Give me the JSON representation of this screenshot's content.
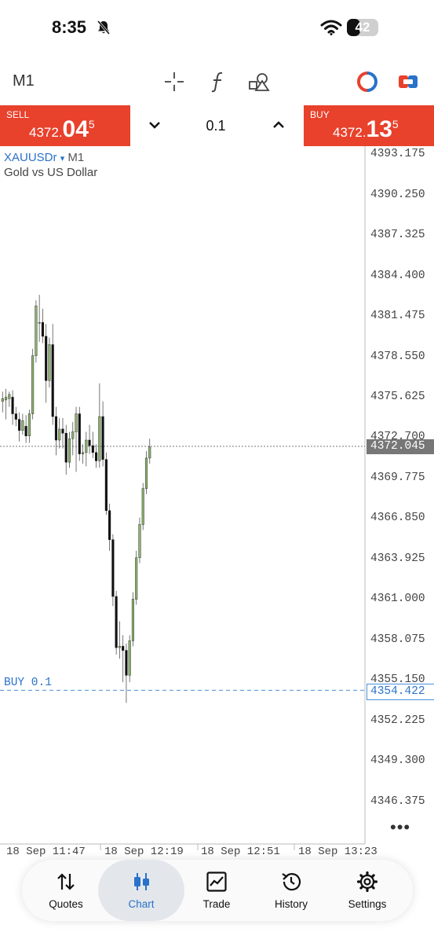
{
  "status": {
    "time": "8:35",
    "battery": "42"
  },
  "toolbar": {
    "timeframe": "M1"
  },
  "trade": {
    "sell": {
      "label": "SELL",
      "price_prefix": "4372.",
      "price_big": "04",
      "price_sup": "5"
    },
    "buy": {
      "label": "BUY",
      "price_prefix": "4372.",
      "price_big": "13",
      "price_sup": "5"
    },
    "volume": "0.1"
  },
  "chart": {
    "symbol": "XAUUSDr",
    "symbol_arrow": "▾",
    "timeframe": "M1",
    "description": "Gold vs US Dollar",
    "price_labels": [
      "4393.175",
      "4390.250",
      "4387.325",
      "4384.400",
      "4381.475",
      "4378.550",
      "4375.625",
      "4372.700",
      "4369.775",
      "4366.850",
      "4363.925",
      "4361.000",
      "4358.075",
      "4355.150",
      "4352.225",
      "4349.300",
      "4346.375"
    ],
    "current_price": "4372.045",
    "position_label": "BUY 0.1",
    "position_price": "4354.422",
    "time_labels": [
      "18 Sep 11:47",
      "18 Sep 12:19",
      "18 Sep 12:51",
      "18 Sep 13:23"
    ],
    "more_label": "•••"
  },
  "chart_data": {
    "type": "candlestick",
    "symbol": "XAUUSDr",
    "timeframe": "M1",
    "ylim": [
      4345.5,
      4394.0
    ],
    "candles": [
      {
        "o": 4375.3,
        "h": 4376.0,
        "l": 4374.5,
        "c": 4375.5
      },
      {
        "o": 4375.4,
        "h": 4376.2,
        "l": 4374.0,
        "c": 4375.6
      },
      {
        "o": 4375.5,
        "h": 4376.0,
        "l": 4374.9,
        "c": 4375.8
      },
      {
        "o": 4375.6,
        "h": 4376.1,
        "l": 4373.6,
        "c": 4374.4
      },
      {
        "o": 4374.4,
        "h": 4374.9,
        "l": 4373.5,
        "c": 4374.0
      },
      {
        "o": 4374.0,
        "h": 4374.5,
        "l": 4372.4,
        "c": 4373.2
      },
      {
        "o": 4373.2,
        "h": 4374.4,
        "l": 4372.9,
        "c": 4373.9
      },
      {
        "o": 4373.5,
        "h": 4374.3,
        "l": 4372.3,
        "c": 4372.8
      },
      {
        "o": 4372.8,
        "h": 4374.7,
        "l": 4372.3,
        "c": 4374.4
      },
      {
        "o": 4374.4,
        "h": 4379.1,
        "l": 4374.0,
        "c": 4378.6
      },
      {
        "o": 4378.6,
        "h": 4382.6,
        "l": 4378.1,
        "c": 4382.2
      },
      {
        "o": 4381.0,
        "h": 4383.0,
        "l": 4379.6,
        "c": 4381.0
      },
      {
        "o": 4381.0,
        "h": 4382.0,
        "l": 4379.5,
        "c": 4380.0
      },
      {
        "o": 4380.0,
        "h": 4380.9,
        "l": 4375.2,
        "c": 4376.8
      },
      {
        "o": 4376.8,
        "h": 4379.9,
        "l": 4376.3,
        "c": 4379.4
      },
      {
        "o": 4379.4,
        "h": 4380.9,
        "l": 4373.6,
        "c": 4374.2
      },
      {
        "o": 4374.2,
        "h": 4374.9,
        "l": 4371.4,
        "c": 4372.5
      },
      {
        "o": 4372.5,
        "h": 4374.1,
        "l": 4371.9,
        "c": 4373.3
      },
      {
        "o": 4373.3,
        "h": 4374.1,
        "l": 4371.9,
        "c": 4373.0
      },
      {
        "o": 4373.0,
        "h": 4373.6,
        "l": 4370.0,
        "c": 4370.9
      },
      {
        "o": 4370.9,
        "h": 4373.1,
        "l": 4370.5,
        "c": 4372.6
      },
      {
        "o": 4372.6,
        "h": 4373.8,
        "l": 4371.4,
        "c": 4373.1
      },
      {
        "o": 4373.1,
        "h": 4374.9,
        "l": 4370.2,
        "c": 4374.4
      },
      {
        "o": 4374.4,
        "h": 4374.9,
        "l": 4371.0,
        "c": 4371.5
      },
      {
        "o": 4371.5,
        "h": 4372.2,
        "l": 4370.8,
        "c": 4371.6
      },
      {
        "o": 4371.6,
        "h": 4373.1,
        "l": 4370.6,
        "c": 4372.5
      },
      {
        "o": 4372.5,
        "h": 4373.6,
        "l": 4371.5,
        "c": 4372.1
      },
      {
        "o": 4372.1,
        "h": 4373.1,
        "l": 4371.2,
        "c": 4371.6
      },
      {
        "o": 4371.6,
        "h": 4372.2,
        "l": 4370.5,
        "c": 4371.0
      },
      {
        "o": 4371.0,
        "h": 4376.6,
        "l": 4370.5,
        "c": 4374.2
      },
      {
        "o": 4374.2,
        "h": 4375.3,
        "l": 4370.6,
        "c": 4371.1
      },
      {
        "o": 4371.1,
        "h": 4371.6,
        "l": 4367.1,
        "c": 4367.4
      },
      {
        "o": 4367.4,
        "h": 4367.9,
        "l": 4364.5,
        "c": 4365.3
      },
      {
        "o": 4365.3,
        "h": 4365.7,
        "l": 4360.5,
        "c": 4361.2
      },
      {
        "o": 4361.2,
        "h": 4361.6,
        "l": 4357.0,
        "c": 4357.5
      },
      {
        "o": 4357.5,
        "h": 4359.4,
        "l": 4356.7,
        "c": 4357.6
      },
      {
        "o": 4357.6,
        "h": 4358.4,
        "l": 4355.0,
        "c": 4357.3
      },
      {
        "o": 4357.3,
        "h": 4357.8,
        "l": 4353.5,
        "c": 4355.5
      },
      {
        "o": 4355.5,
        "h": 4358.4,
        "l": 4355.0,
        "c": 4358.0
      },
      {
        "o": 4358.0,
        "h": 4361.5,
        "l": 4357.6,
        "c": 4361.0
      },
      {
        "o": 4361.0,
        "h": 4364.5,
        "l": 4360.6,
        "c": 4364.0
      },
      {
        "o": 4364.0,
        "h": 4366.9,
        "l": 4363.6,
        "c": 4366.4
      },
      {
        "o": 4366.4,
        "h": 4369.4,
        "l": 4366.0,
        "c": 4369.0
      },
      {
        "o": 4369.0,
        "h": 4371.7,
        "l": 4368.6,
        "c": 4371.2
      },
      {
        "o": 4371.2,
        "h": 4372.6,
        "l": 4370.8,
        "c": 4372.0
      }
    ],
    "reference_lines": [
      {
        "label": "",
        "value": 4372.045,
        "style": "dotted-gray"
      },
      {
        "label": "BUY 0.1",
        "value": 4354.422,
        "style": "dashed-blue"
      }
    ],
    "bull_color": "#8db36b",
    "bear_color": "#111111"
  },
  "nav": {
    "items": [
      {
        "label": "Quotes",
        "icon": "quotes-icon"
      },
      {
        "label": "Chart",
        "icon": "chart-icon"
      },
      {
        "label": "Trade",
        "icon": "trade-icon"
      },
      {
        "label": "History",
        "icon": "history-icon"
      },
      {
        "label": "Settings",
        "icon": "settings-icon"
      }
    ],
    "active": "Chart"
  },
  "colors": {
    "sell": "#e8412c",
    "buy": "#e8412c",
    "accent": "#2a72c9"
  }
}
